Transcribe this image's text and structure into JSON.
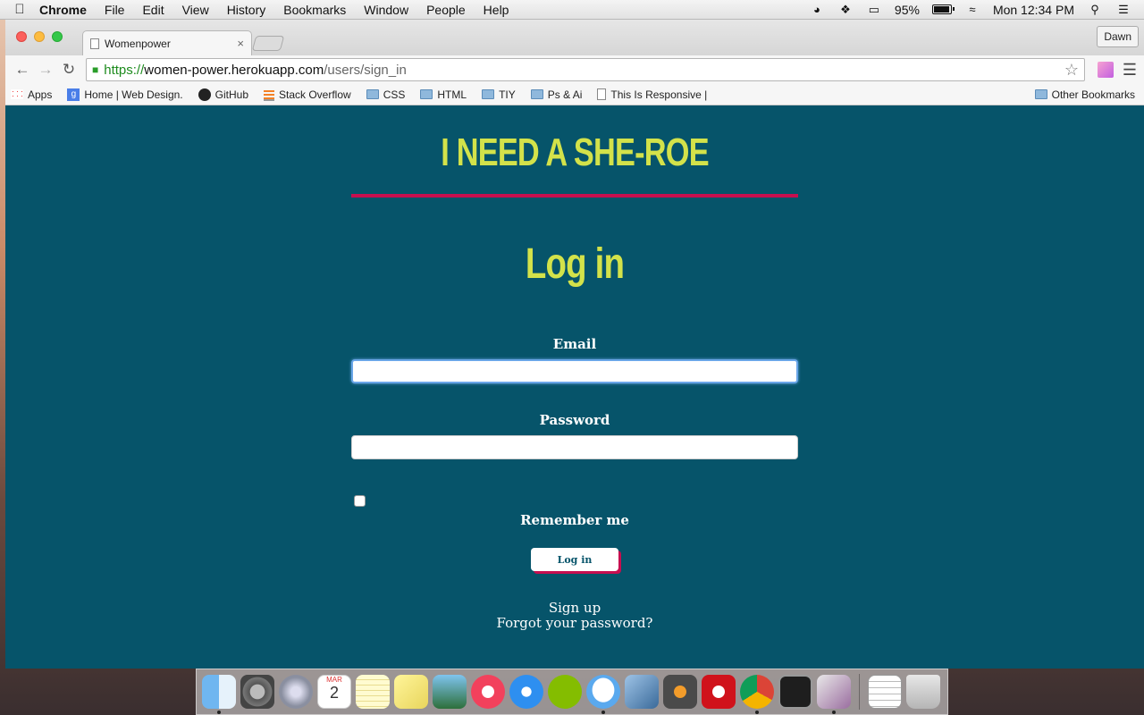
{
  "menubar": {
    "app_name": "Chrome",
    "items": [
      "File",
      "Edit",
      "View",
      "History",
      "Bookmarks",
      "Window",
      "People",
      "Help"
    ],
    "battery": "95%",
    "clock": "Mon 12:34 PM"
  },
  "browser": {
    "tab_title": "Womenpower",
    "tab_close": "×",
    "profile": "Dawn",
    "url": {
      "scheme": "https://",
      "host": "women-power.herokuapp.com",
      "path": "/users/sign_in"
    },
    "bookmarks": [
      "Apps",
      "Home | Web Design.",
      "GitHub",
      "Stack Overflow",
      "CSS",
      "HTML",
      "TIY",
      "Ps & Ai",
      "This Is Responsive |"
    ],
    "other_bookmarks": "Other Bookmarks"
  },
  "page": {
    "site_title": "I NEED A SHE-ROE",
    "heading": "Log in",
    "email_label": "Email",
    "password_label": "Password",
    "remember_label": "Remember me",
    "login_button": "Log in",
    "signup_link": "Sign up",
    "forgot_link": "Forgot your password?"
  },
  "colors": {
    "page_background": "#06546a",
    "title_color": "#d3e24a",
    "accent": "#c70f4f"
  },
  "dock": {
    "apps": [
      "finder",
      "system-preferences",
      "launchpad",
      "calendar",
      "notes",
      "stickies",
      "iphoto",
      "itunes",
      "app-store",
      "spotify",
      "messages",
      "preview",
      "sublime-text",
      "creative-cloud",
      "chrome",
      "terminal",
      "slack",
      "downloads",
      "trash"
    ],
    "calendar_month": "MAR",
    "calendar_day": "2"
  }
}
